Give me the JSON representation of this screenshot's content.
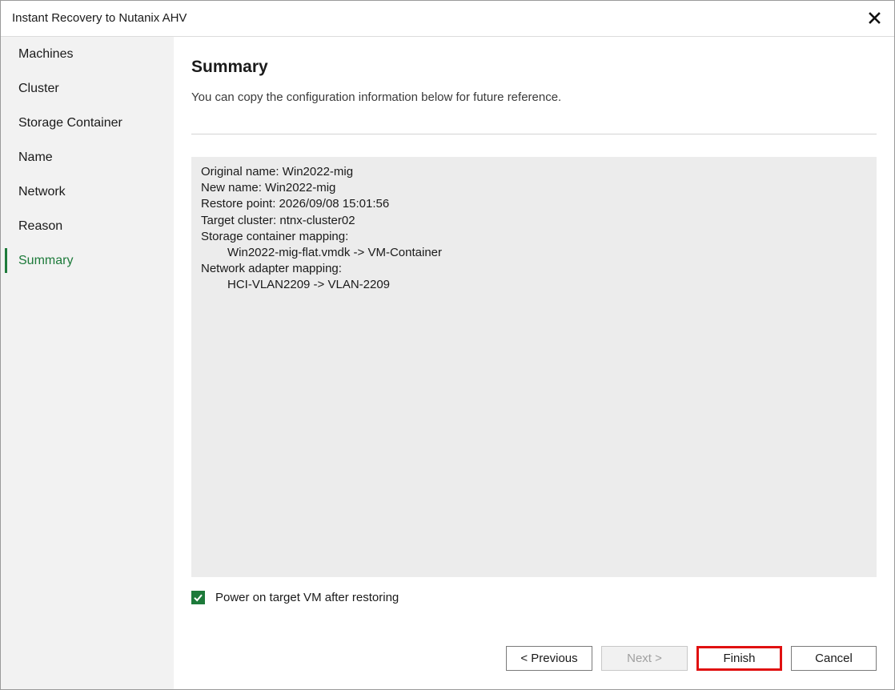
{
  "window": {
    "title": "Instant Recovery to Nutanix AHV",
    "close_icon": "close-icon"
  },
  "sidebar": {
    "items": [
      {
        "label": "Machines",
        "active": false
      },
      {
        "label": "Cluster",
        "active": false
      },
      {
        "label": "Storage Container",
        "active": false
      },
      {
        "label": "Name",
        "active": false
      },
      {
        "label": "Network",
        "active": false
      },
      {
        "label": "Reason",
        "active": false
      },
      {
        "label": "Summary",
        "active": true
      }
    ]
  },
  "main": {
    "title": "Summary",
    "subtitle": "You can copy the configuration information below for future reference.",
    "summary_lines": [
      {
        "text": "Original name: Win2022-mig",
        "indent": false
      },
      {
        "text": "New name: Win2022-mig",
        "indent": false
      },
      {
        "text": "Restore point: 2026/09/08 15:01:56",
        "indent": false
      },
      {
        "text": "Target cluster: ntnx-cluster02",
        "indent": false
      },
      {
        "text": "Storage container mapping:",
        "indent": false
      },
      {
        "text": "Win2022-mig-flat.vmdk -> VM-Container",
        "indent": true
      },
      {
        "text": "Network adapter mapping:",
        "indent": false
      },
      {
        "text": "HCI-VLAN2209 -> VLAN-2209",
        "indent": true
      }
    ],
    "power_on_checkbox": {
      "label": "Power on target VM after restoring",
      "checked": true
    }
  },
  "buttons": {
    "previous": "< Previous",
    "next": "Next >",
    "finish": "Finish",
    "cancel": "Cancel"
  },
  "colors": {
    "accent": "#1d7a3a",
    "highlight": "#e01010",
    "sidebar_bg": "#f2f2f2",
    "summary_bg": "#ececec"
  }
}
